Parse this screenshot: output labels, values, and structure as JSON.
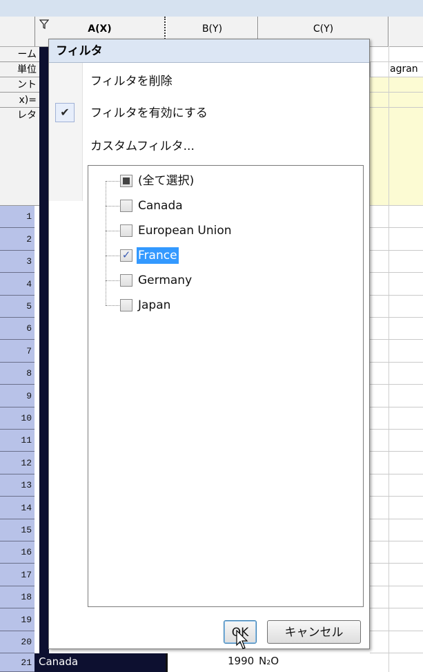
{
  "columns": {
    "a_label": "A(X)",
    "b_label": "B(Y)",
    "c_label": "C(Y)"
  },
  "left_meta_labels": [
    "ーム",
    "単位",
    "ント",
    "x)=",
    "レタ"
  ],
  "partial_cell_text": "agran",
  "row_numbers": [
    "1",
    "2",
    "3",
    "4",
    "5",
    "6",
    "7",
    "8",
    "9",
    "10",
    "11",
    "12",
    "13",
    "14",
    "15",
    "16",
    "17",
    "18",
    "19",
    "20",
    "21"
  ],
  "row21": {
    "col_a": "Canada",
    "col_b": "1990",
    "col_c": "N₂O"
  },
  "dialog": {
    "title": "フィルタ",
    "menu": {
      "remove_filter": "フィルタを削除",
      "enable_filter": "フィルタを有効にする",
      "enable_filter_checked": true,
      "custom_filter": "カスタムフィルタ..."
    },
    "list_items": [
      {
        "label": "(全て選択)",
        "state": "indeterminate"
      },
      {
        "label": "Canada",
        "state": "unchecked"
      },
      {
        "label": "European Union",
        "state": "unchecked"
      },
      {
        "label": "France",
        "state": "checked",
        "selected": true
      },
      {
        "label": "Germany",
        "state": "unchecked"
      },
      {
        "label": "Japan",
        "state": "unchecked"
      }
    ],
    "ok_label": "OK",
    "cancel_label": "キャンセル"
  },
  "icons": {
    "filter_icon": "funnel-icon",
    "menu_check": "checkmark-icon",
    "cursor": "mouse-pointer-icon"
  },
  "colors": {
    "selection": "#3399ff",
    "row_header": "#b8c2e8",
    "title_bar": "#dce6f4",
    "yellow_row": "#fcfbd3"
  }
}
